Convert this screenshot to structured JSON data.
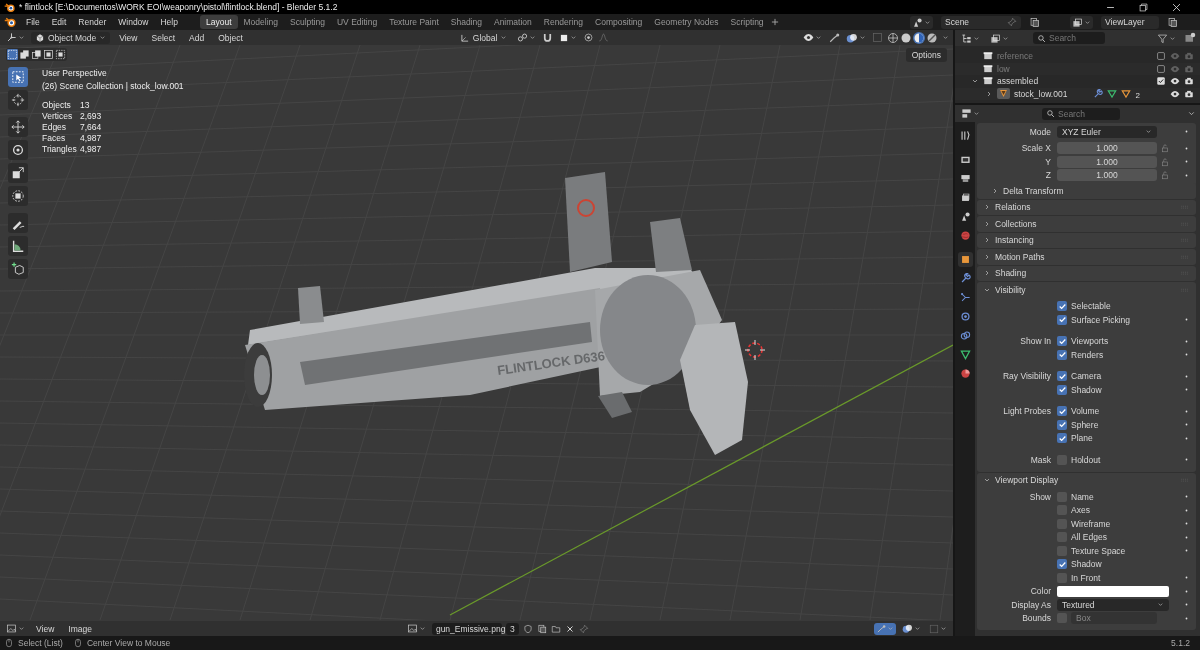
{
  "window": {
    "title": "* flintlock [E:\\Documentos\\WORK EOI\\weaponry\\pistol\\flintlock.blend] - Blender 5.1.2"
  },
  "menu": [
    "File",
    "Edit",
    "Render",
    "Window",
    "Help"
  ],
  "workspaces": [
    {
      "label": "Layout",
      "selected": true
    },
    {
      "label": "Modeling",
      "selected": false
    },
    {
      "label": "Sculpting",
      "selected": false
    },
    {
      "label": "UV Editing",
      "selected": false
    },
    {
      "label": "Texture Paint",
      "selected": false
    },
    {
      "label": "Shading",
      "selected": false
    },
    {
      "label": "Animation",
      "selected": false
    },
    {
      "label": "Rendering",
      "selected": false
    },
    {
      "label": "Compositing",
      "selected": false
    },
    {
      "label": "Geometry Nodes",
      "selected": false
    },
    {
      "label": "Scripting",
      "selected": false
    }
  ],
  "scene": "Scene",
  "view_layer": "ViewLayer",
  "viewport_header": {
    "mode": "Object Mode",
    "menus": [
      "View",
      "Select",
      "Add",
      "Object"
    ],
    "orientation": "Global",
    "options": "Options",
    "shading_modes": [
      {
        "kind": "wireframe",
        "selected": false
      },
      {
        "kind": "solid",
        "selected": false
      },
      {
        "kind": "material",
        "selected": true
      },
      {
        "kind": "rendered",
        "selected": false
      }
    ]
  },
  "select_modes": [
    {
      "kind": "set",
      "selected": true
    },
    {
      "kind": "extend",
      "selected": false
    },
    {
      "kind": "subtract",
      "selected": false
    },
    {
      "kind": "invert",
      "selected": false
    },
    {
      "kind": "intersect",
      "selected": false
    }
  ],
  "toolbar": [
    {
      "kind": "select_box",
      "selected": true
    },
    {
      "kind": "cursor",
      "selected": false
    },
    {
      "kind": "move",
      "selected": false
    },
    {
      "kind": "rotate",
      "selected": false
    },
    {
      "kind": "scale",
      "selected": false
    },
    {
      "kind": "transform",
      "selected": false
    },
    {
      "kind": "annotate",
      "selected": false
    },
    {
      "kind": "measure",
      "selected": false
    },
    {
      "kind": "add_cube",
      "selected": false
    }
  ],
  "overlay": {
    "perspective": "User Perspective",
    "collection": "(26) Scene Collection | stock_low.001",
    "stats": [
      {
        "label": "Objects",
        "value": "13"
      },
      {
        "label": "Vertices",
        "value": "2,693"
      },
      {
        "label": "Edges",
        "value": "7,664"
      },
      {
        "label": "Faces",
        "value": "4,987"
      },
      {
        "label": "Triangles",
        "value": "4,987"
      }
    ]
  },
  "engraving": "FLINTLOCK D636",
  "image_header": {
    "menus": [
      "View",
      "Image"
    ],
    "image": "gun_Emissive.png",
    "users": "3"
  },
  "status_bar": {
    "hints": [
      "Select (List)",
      "Center View to Mouse"
    ],
    "version": "5.1.2"
  },
  "outliner": {
    "search_placeholder": "Search",
    "items": [
      {
        "name": "reference",
        "kind": "collection",
        "checked": false
      },
      {
        "name": "low",
        "kind": "collection",
        "checked": false
      },
      {
        "name": "assembled",
        "kind": "collection",
        "checked": true,
        "expanded": true,
        "children": [
          {
            "name": "stock_low.001",
            "kind": "object",
            "expanded": false,
            "material_count": "2"
          }
        ]
      }
    ]
  },
  "properties": {
    "search_placeholder": "Search",
    "tabs": [
      {
        "kind": "tool",
        "selected": false
      },
      {
        "kind": "render",
        "selected": false
      },
      {
        "kind": "output",
        "selected": false
      },
      {
        "kind": "view_layer",
        "selected": false
      },
      {
        "kind": "scene",
        "selected": false
      },
      {
        "kind": "world",
        "selected": false
      },
      {
        "kind": "object",
        "selected": true
      },
      {
        "kind": "modifiers",
        "selected": false
      },
      {
        "kind": "particles",
        "selected": false
      },
      {
        "kind": "physics",
        "selected": false
      },
      {
        "kind": "constraints",
        "selected": false
      },
      {
        "kind": "data",
        "selected": false
      },
      {
        "kind": "material",
        "selected": false
      }
    ],
    "transform_rows": [
      {
        "kind": "dropdown",
        "label": "Mode",
        "value": "XYZ Euler",
        "keyable": true
      },
      {
        "kind": "number",
        "label": "Scale X",
        "value": "1.000",
        "locked": false,
        "keyable": true
      },
      {
        "kind": "number",
        "label": "Y",
        "value": "1.000",
        "locked": false,
        "keyable": true
      },
      {
        "kind": "number",
        "label": "Z",
        "value": "1.000",
        "locked": false,
        "keyable": true
      }
    ],
    "panels": [
      {
        "kind": "subpanel",
        "title": "Delta Transform",
        "expanded": false
      },
      {
        "kind": "panel",
        "title": "Relations",
        "expanded": false
      },
      {
        "kind": "panel",
        "title": "Collections",
        "expanded": false
      },
      {
        "kind": "panel",
        "title": "Instancing",
        "expanded": false
      },
      {
        "kind": "panel",
        "title": "Motion Paths",
        "expanded": false
      },
      {
        "kind": "panel",
        "title": "Shading",
        "expanded": false
      },
      {
        "kind": "panel",
        "title": "Visibility",
        "expanded": true,
        "rows": [
          {
            "kind": "check",
            "text": "Selectable",
            "checked": true,
            "keyable": false
          },
          {
            "kind": "check",
            "text": "Surface Picking",
            "checked": true,
            "keyable": true
          },
          {
            "kind": "check",
            "label": "Show In",
            "text": "Viewports",
            "checked": true,
            "keyable": true
          },
          {
            "kind": "check",
            "text": "Renders",
            "checked": true,
            "keyable": true
          },
          {
            "kind": "check",
            "label": "Ray Visibility",
            "text": "Camera",
            "checked": true,
            "keyable": true
          },
          {
            "kind": "check",
            "text": "Shadow",
            "checked": true,
            "keyable": true
          },
          {
            "kind": "check",
            "label": "Light Probes",
            "text": "Volume",
            "checked": true,
            "keyable": true
          },
          {
            "kind": "check",
            "text": "Sphere",
            "checked": true,
            "keyable": true
          },
          {
            "kind": "check",
            "text": "Plane",
            "checked": true,
            "keyable": true
          },
          {
            "kind": "check",
            "label": "Mask",
            "text": "Holdout",
            "checked": false,
            "keyable": true
          }
        ]
      },
      {
        "kind": "panel",
        "title": "Viewport Display",
        "expanded": true,
        "rows": [
          {
            "kind": "check",
            "label": "Show",
            "text": "Name",
            "checked": false,
            "keyable": true
          },
          {
            "kind": "check",
            "text": "Axes",
            "checked": false,
            "keyable": true
          },
          {
            "kind": "check",
            "text": "Wireframe",
            "checked": false,
            "keyable": true
          },
          {
            "kind": "check",
            "text": "All Edges",
            "checked": false,
            "keyable": true
          },
          {
            "kind": "check",
            "text": "Texture Space",
            "checked": false,
            "keyable": true
          },
          {
            "kind": "check",
            "text": "Shadow",
            "checked": true,
            "keyable": false
          },
          {
            "kind": "check",
            "text": "In Front",
            "checked": false,
            "keyable": true
          },
          {
            "kind": "color",
            "label": "Color",
            "color": "#ffffff",
            "keyable": true
          },
          {
            "kind": "dropdown",
            "label": "Display As",
            "value": "Textured",
            "keyable": true
          },
          {
            "kind": "check_dropdown",
            "label": "Bounds",
            "checked": false,
            "value": "Box",
            "keyable": true
          }
        ]
      }
    ]
  }
}
